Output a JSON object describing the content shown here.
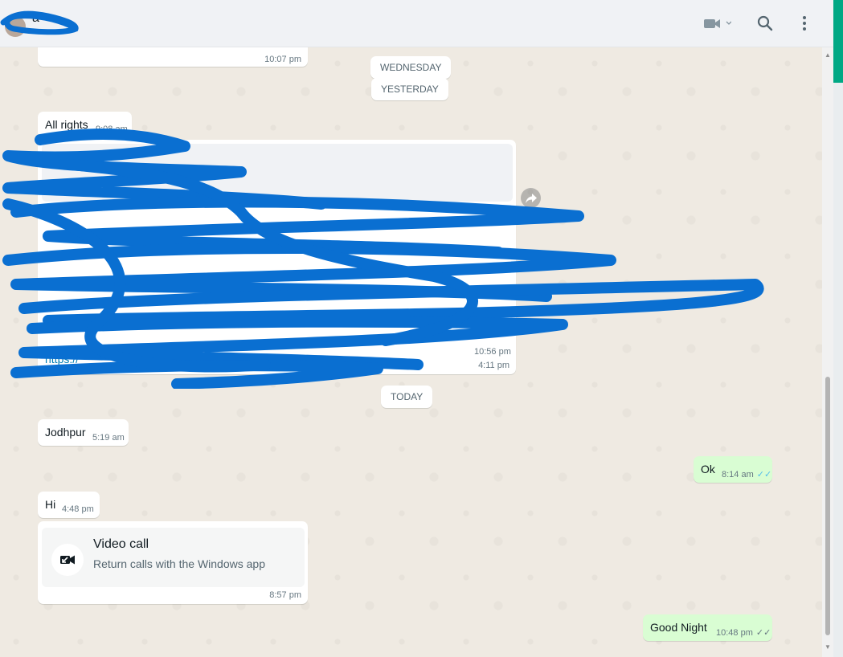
{
  "header": {
    "contact_name": "a",
    "video_icon": "video-camera-icon",
    "search_icon": "search-icon",
    "menu_icon": "more-vertical-icon"
  },
  "messages": {
    "m0_time": "10:07 pm",
    "day_wednesday": "WEDNESDAY",
    "day_yesterday": "YESTERDAY",
    "m1_text": "All rights",
    "m1_time": "9:08 am",
    "m2_link": "https://",
    "m2_time_inner": "10:56 pm",
    "m2_time": "4:11 pm",
    "day_today": "TODAY",
    "m3_text": "Jodhpur",
    "m3_time": "5:19 am",
    "m4_text": "Ok",
    "m4_time": "8:14 am",
    "m5_text": "Hi",
    "m5_time": "4:48 pm",
    "m6_time": "8:57 pm",
    "m7_text": "Good Night",
    "m7_time": "10:48 pm",
    "ticks": "✓✓"
  },
  "video_call": {
    "title": "Video call",
    "subtitle": "Return calls with the Windows app",
    "icon": "missed-video-call-icon"
  },
  "colors": {
    "accent": "#00a884",
    "outgoing_bubble": "#d9fdd3",
    "chat_background": "#efeae2",
    "read_ticks": "#53bdeb",
    "scribble": "#0a6fd1"
  }
}
